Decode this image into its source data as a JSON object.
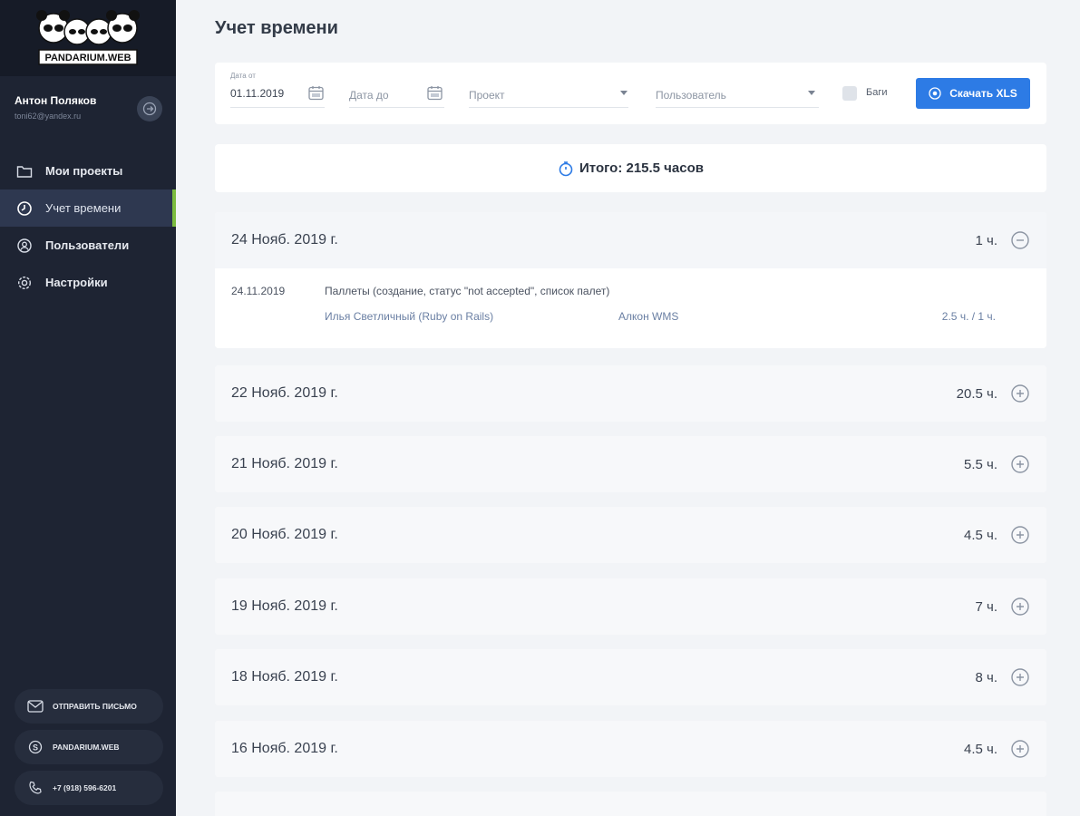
{
  "brand": {
    "logo_text": "PANDARIUM.WEB"
  },
  "profile": {
    "name": "Антон Поляков",
    "email": "toni62@yandex.ru"
  },
  "nav": [
    {
      "label": "Мои проекты",
      "icon": "folder-icon",
      "active": false
    },
    {
      "label": "Учет времени",
      "icon": "timer-icon",
      "active": true
    },
    {
      "label": "Пользователи",
      "icon": "user-icon",
      "active": false
    },
    {
      "label": "Настройки",
      "icon": "gear-icon",
      "active": false
    }
  ],
  "side_links": [
    {
      "label": "ОТПРАВИТЬ ПИСЬМО",
      "icon": "mail-icon"
    },
    {
      "label": "PANDARIUM.WEB",
      "icon": "skype-icon"
    },
    {
      "label": "+7 (918) 596-6201",
      "icon": "phone-icon"
    }
  ],
  "page": {
    "title": "Учет времени"
  },
  "filters": {
    "date_from_label": "Дата от",
    "date_from_value": "01.11.2019",
    "date_to_placeholder": "Дата до",
    "project_placeholder": "Проект",
    "user_placeholder": "Пользователь",
    "bugs_label": "Баги",
    "bugs_checked": false,
    "download_label": "Скачать XLS"
  },
  "total": {
    "label": "Итого: 215.5 часов"
  },
  "days": [
    {
      "date": "24 Нояб. 2019 г.",
      "hours": "1 ч.",
      "expanded": true,
      "entries": [
        {
          "date": "24.11.2019",
          "task": "Паллеты (создание, статус \"not accepted\", список палет)",
          "user": "Илья Светличный (Ruby on Rails)",
          "project": "Алкон WMS",
          "time": "2.5 ч. / 1 ч."
        }
      ]
    },
    {
      "date": "22 Нояб. 2019 г.",
      "hours": "20.5 ч.",
      "expanded": false
    },
    {
      "date": "21 Нояб. 2019 г.",
      "hours": "5.5 ч.",
      "expanded": false
    },
    {
      "date": "20 Нояб. 2019 г.",
      "hours": "4.5 ч.",
      "expanded": false
    },
    {
      "date": "19 Нояб. 2019 г.",
      "hours": "7 ч.",
      "expanded": false
    },
    {
      "date": "18 Нояб. 2019 г.",
      "hours": "8 ч.",
      "expanded": false
    },
    {
      "date": "16 Нояб. 2019 г.",
      "hours": "4.5 ч.",
      "expanded": false
    }
  ],
  "colors": {
    "sidebar_bg": "#1e2433",
    "active_bar": "#7cbc3f",
    "primary_button": "#2d7be5",
    "page_bg": "#f2f4f7"
  }
}
